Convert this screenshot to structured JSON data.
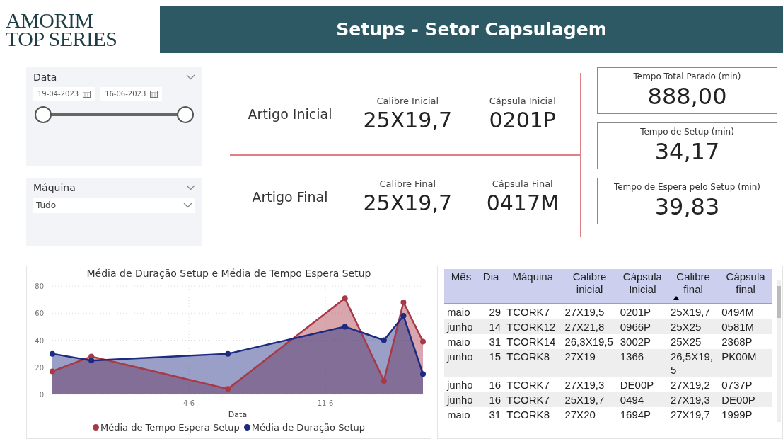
{
  "logo": {
    "line_1": "AMORIM",
    "line_2": "TOP SERIES"
  },
  "header": {
    "title": "Setups - Setor Capsulagem"
  },
  "date_slicer": {
    "title": "Data",
    "start": "19-04-2023",
    "end": "16-06-2023",
    "start_handle": {
      "level": 0
    },
    "end_handle": {
      "level": 1
    }
  },
  "machine_slicer": {
    "title": "Máquina",
    "value": "Tudo"
  },
  "articles": [
    {
      "label": "Artigo Inicial",
      "fields": [
        {
          "label": "Calibre Inicial",
          "value": "25X19,7"
        },
        {
          "label": "Cápsula Inicial",
          "value": "0201P"
        }
      ]
    },
    {
      "label": "Artigo Final",
      "fields": [
        {
          "label": "Calibre Final",
          "value": "25X19,7"
        },
        {
          "label": "Cápsula Final",
          "value": "0417M"
        }
      ]
    }
  ],
  "kpis": [
    {
      "label": "Tempo Total Parado (min)",
      "value": "888,00"
    },
    {
      "label": "Tempo de Setup (min)",
      "value": "34,17"
    },
    {
      "label": "Tempo de Espera pelo Setup (min)",
      "value": "39,83"
    }
  ],
  "chart": {
    "chart_data": {
      "type": "area",
      "title": "Média de Duração Setup e Média de Tempo Espera Setup",
      "xlabel": "Data",
      "categories": [
        null,
        null,
        null,
        null,
        null,
        null,
        null,
        "4-6",
        null,
        null,
        null,
        null,
        null,
        null,
        "11-6",
        null,
        null,
        null,
        null,
        null
      ],
      "ylim": [
        0,
        80
      ],
      "yticks": [
        0,
        20,
        40,
        60,
        80
      ],
      "grid": true,
      "series": [
        {
          "name": "Média de Tempo Espera Setup",
          "color": "#a83a48",
          "values": [
            17,
            null,
            28,
            null,
            null,
            null,
            null,
            null,
            null,
            4,
            null,
            null,
            null,
            null,
            null,
            71,
            null,
            10,
            68,
            39
          ]
        },
        {
          "name": "Média de Duração Setup",
          "color": "#1c2a80",
          "values": [
            30,
            null,
            25,
            null,
            null,
            null,
            null,
            null,
            null,
            30,
            null,
            null,
            null,
            null,
            null,
            50,
            null,
            40,
            58,
            15
          ]
        }
      ]
    }
  },
  "table": {
    "columns": [
      {
        "label": "Mês",
        "sorted": false
      },
      {
        "label": "Dia",
        "sorted": false
      },
      {
        "label": "Máquina",
        "sorted": false
      },
      {
        "label": "Calibre inicial",
        "sorted": false
      },
      {
        "label": "Cápsula Inicial",
        "sorted": false
      },
      {
        "label": "Calibre final",
        "sorted": true
      },
      {
        "label": "Cápsula final",
        "sorted": false
      }
    ],
    "rows": [
      [
        "maio",
        "29",
        "TCORK7",
        "27X19,5",
        "0201P",
        "25X19,7",
        "0494M"
      ],
      [
        "junho",
        "14",
        "TCORK12",
        "27X21,8",
        "0966P",
        "25X25",
        "0581M"
      ],
      [
        "maio",
        "31",
        "TCORK14",
        "26,3X19,5",
        "3002P",
        "25X25",
        "2368P"
      ],
      [
        "junho",
        "15",
        "TCORK8",
        "27X19",
        "1366",
        "26,5X19,5",
        "PK00M"
      ],
      [
        "junho",
        "16",
        "TCORK7",
        "27X19,3",
        "DE00P",
        "27X19,2",
        "0737P"
      ],
      [
        "junho",
        "16",
        "TCORK7",
        "25X19,7",
        "0494",
        "27X19,3",
        "DE00P"
      ],
      [
        "maio",
        "31",
        "TCORK8",
        "27X20",
        "1694P",
        "27X19,7",
        "1999P"
      ]
    ]
  }
}
